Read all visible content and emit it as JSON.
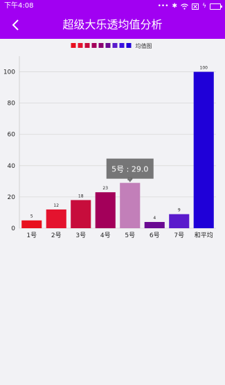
{
  "status_bar": {
    "time": "下午4:08",
    "icons": [
      "dots-icon",
      "bluetooth-icon",
      "wifi-icon",
      "close-box-icon",
      "charging-icon",
      "battery-icon"
    ]
  },
  "header": {
    "title": "超级大乐透均值分析",
    "back_icon": "back-arrow-icon",
    "background": "#a100f2"
  },
  "chart_data": {
    "type": "bar",
    "categories": [
      "1号",
      "2号",
      "3号",
      "4号",
      "5号",
      "6号",
      "7号",
      "和平均"
    ],
    "values": [
      5,
      12,
      18,
      23,
      29,
      4,
      9,
      100
    ],
    "colors": [
      "#e8101e",
      "#e4132e",
      "#c70d3c",
      "#a3005a",
      "#c27fb9",
      "#6a0a92",
      "#5a1bcc",
      "#1f00d8"
    ],
    "ylim": [
      0,
      110
    ],
    "yticks": [
      0,
      20,
      40,
      60,
      80,
      100
    ],
    "legend": {
      "label": "均值图",
      "position": "top-center",
      "swatch_colors": [
        "#e8101e",
        "#e4132e",
        "#c70d3c",
        "#a3005a",
        "#8a0070",
        "#6a0a92",
        "#5a1bcc",
        "#3a10e0",
        "#1f00d8"
      ]
    },
    "grid": true,
    "highlight": {
      "index": 4,
      "tooltip": "5号 : 29.0"
    }
  }
}
